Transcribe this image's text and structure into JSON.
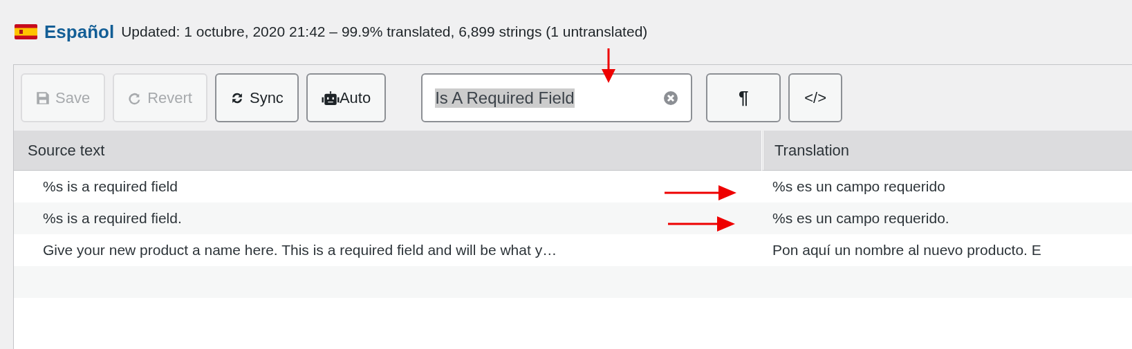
{
  "header": {
    "language": "Español",
    "summary": "Updated: 1 octubre, 2020 21:42 – 99.9% translated, 6,899 strings (1 untranslated)"
  },
  "toolbar": {
    "buttons": [
      {
        "kind": "save",
        "label": "Save",
        "disabled": true
      },
      {
        "kind": "revert",
        "label": "Revert",
        "disabled": true
      },
      {
        "kind": "sync",
        "label": "Sync",
        "disabled": false
      },
      {
        "kind": "auto",
        "label": "Auto",
        "disabled": false
      }
    ],
    "search": {
      "value": "Is A Required Field"
    },
    "toggles": [
      {
        "kind": "pilcrow",
        "label": "¶"
      },
      {
        "kind": "code",
        "label": "</>"
      }
    ]
  },
  "table": {
    "columns": [
      "Source text",
      "Translation"
    ],
    "rows": [
      {
        "source": "%s is a required field",
        "translation": "%s es un campo requerido"
      },
      {
        "source": "%s is a required field.",
        "translation": "%s es un campo requerido."
      },
      {
        "source": "Give your new product a name here. This is a required field and will be what y…",
        "translation": "Pon aquí un nombre al nuevo producto. E"
      }
    ]
  }
}
